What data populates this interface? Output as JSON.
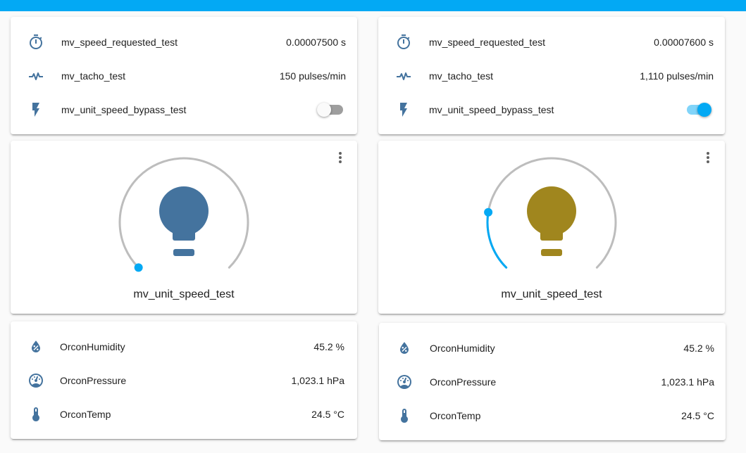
{
  "colors": {
    "accent": "#03a9f4",
    "icon": "#44739e",
    "bulb_on": "#a0861e",
    "slider_track": "#bdbdbd"
  },
  "entity_cards": [
    {
      "rows": [
        {
          "icon": "timer-icon",
          "name": "mv_speed_requested_test",
          "value": "0.00007500 s"
        },
        {
          "icon": "pulse-icon",
          "name": "mv_tacho_test",
          "value": "150 pulses/min"
        },
        {
          "icon": "flash-icon",
          "name": "mv_unit_speed_bypass_test",
          "toggle": false
        }
      ]
    },
    {
      "rows": [
        {
          "icon": "timer-icon",
          "name": "mv_speed_requested_test",
          "value": "0.00007600 s"
        },
        {
          "icon": "pulse-icon",
          "name": "mv_tacho_test",
          "value": "1,110 pulses/min"
        },
        {
          "icon": "flash-icon",
          "name": "mv_unit_speed_bypass_test",
          "toggle": true
        }
      ]
    }
  ],
  "light_cards": [
    {
      "name": "mv_unit_speed_test",
      "state": "off",
      "brightness_fraction": 0.0
    },
    {
      "name": "mv_unit_speed_test",
      "state": "on",
      "brightness_fraction": 0.2
    }
  ],
  "sensor_cards": [
    {
      "rows": [
        {
          "icon": "water-percent-icon",
          "name": "OrconHumidity",
          "value": "45.2 %"
        },
        {
          "icon": "gauge-icon",
          "name": "OrconPressure",
          "value": "1,023.1 hPa"
        },
        {
          "icon": "thermometer-icon",
          "name": "OrconTemp",
          "value": "24.5 °C"
        }
      ]
    },
    {
      "rows": [
        {
          "icon": "water-percent-icon",
          "name": "OrconHumidity",
          "value": "45.2 %"
        },
        {
          "icon": "gauge-icon",
          "name": "OrconPressure",
          "value": "1,023.1 hPa"
        },
        {
          "icon": "thermometer-icon",
          "name": "OrconTemp",
          "value": "24.5 °C"
        }
      ]
    }
  ]
}
